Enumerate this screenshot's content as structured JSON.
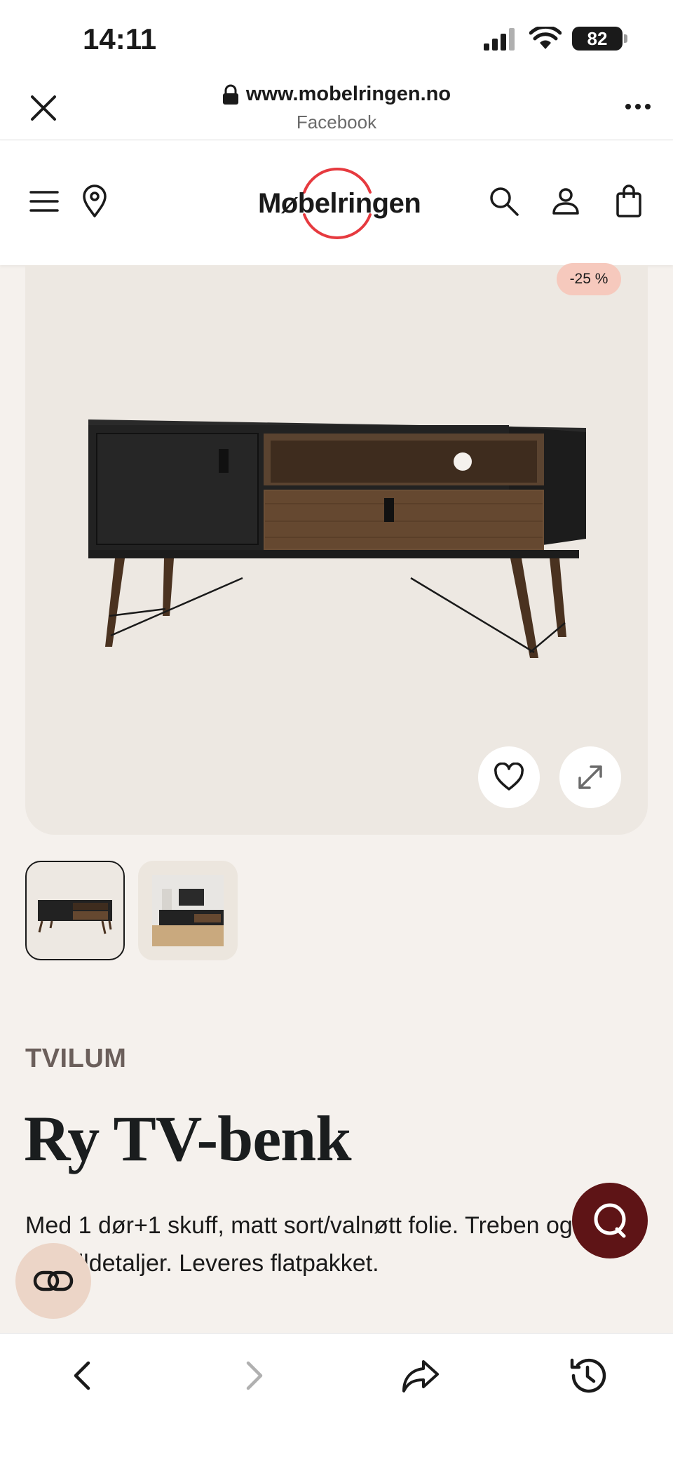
{
  "status_bar": {
    "time": "14:11",
    "battery": "82"
  },
  "browser": {
    "url": "www.mobelringen.no",
    "source": "Facebook"
  },
  "site": {
    "logo_text": "Møbelringen",
    "logo_ring_color": "#e63a3f"
  },
  "product": {
    "discount": "-25 %",
    "brand": "TVILUM",
    "title": "Ry TV-benk",
    "description": "Med 1 dør+1 skuff, matt sort/valnøtt folie. Treben og metalldetaljer. Leveres flatpakket.",
    "selected_thumbnail": 1,
    "thumbnails": [
      "thumbnail-product",
      "thumbnail-room"
    ]
  },
  "colors": {
    "accent_chat": "#5e1416",
    "badge": "#f6c9bd",
    "page_bg": "#f5f1ed"
  },
  "icons": {
    "header": [
      "menu-icon",
      "location-icon",
      "search-icon",
      "account-icon",
      "bag-icon"
    ],
    "product": [
      "heart-icon",
      "expand-icon"
    ],
    "bottom_nav": [
      "back-icon",
      "forward-icon",
      "share-icon",
      "history-icon"
    ],
    "floating": [
      "chat-icon",
      "compare-icon"
    ]
  }
}
